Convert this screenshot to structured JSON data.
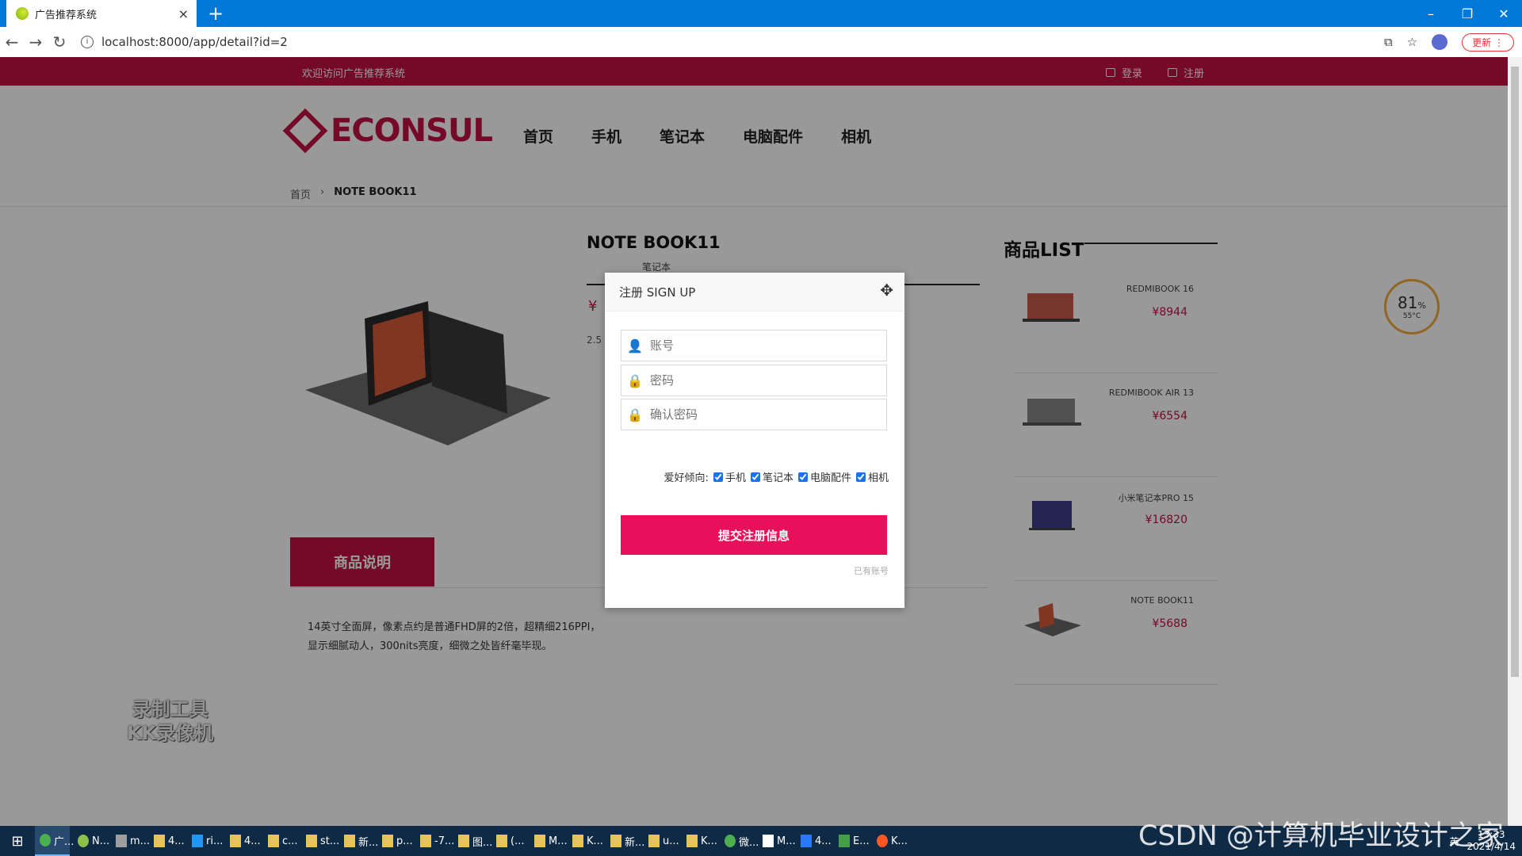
{
  "browser": {
    "tab_title": "广告推荐系统",
    "tab_close": "×",
    "new_tab": "+",
    "url": "localhost:8000/app/detail?id=2",
    "update_button": "更新",
    "window_controls": [
      "–",
      "❐",
      "✕"
    ]
  },
  "site": {
    "welcome": "欢迎访问广告推荐系统",
    "login": "登录",
    "register": "注册",
    "logo": "ECONSUL",
    "nav": [
      "首页",
      "手机",
      "笔记本",
      "电脑配件",
      "相机"
    ],
    "breadcrumb": {
      "home": "首页",
      "current": "NOTE BOOK11"
    }
  },
  "product": {
    "title": "NOTE BOOK11",
    "category": "笔记本",
    "price_symbol": "¥",
    "misc": "2.5",
    "description_tab": "商品说明",
    "description": "14英寸全面屏，像素点约是普通FHD屏的2倍，超精细216PPI，显示细腻动人，300nits亮度，细微之处皆纤毫毕现。"
  },
  "product_list": {
    "title": "商品LIST",
    "items": [
      {
        "name": "REDMIBOOK 16",
        "price": "¥8944"
      },
      {
        "name": "REDMIBOOK AIR 13",
        "price": "¥6554"
      },
      {
        "name": "小米笔记本PRO 15",
        "price": "¥16820"
      },
      {
        "name": "NOTE BOOK11",
        "price": "¥5688"
      }
    ]
  },
  "modal": {
    "title": "注册 SIGN UP",
    "account_placeholder": "账号",
    "password_placeholder": "密码",
    "confirm_placeholder": "确认密码",
    "prefs_label": "爱好倾向:",
    "prefs": [
      "手机",
      "笔记本",
      "电脑配件",
      "相机"
    ],
    "submit": "提交注册信息",
    "have_account": "已有账号"
  },
  "gauge": {
    "percent": "81",
    "unit": "%",
    "temp": "55°C"
  },
  "watermark": {
    "line1": "录制工具",
    "line2": "KK录像机",
    "csdn": "CSDN @计算机毕业设计之家"
  },
  "taskbar": {
    "items": [
      "广...",
      "N...",
      "m...",
      "4...",
      "ri...",
      "4...",
      "c...",
      "st...",
      "新...",
      "p...",
      "-7...",
      "图...",
      "(...",
      "M...",
      "K...",
      "新...",
      "u...",
      "K...",
      "微...",
      "M...",
      "4...",
      "E...",
      "K..."
    ],
    "lang": "英",
    "time": "13:33",
    "date": "2021/4/14"
  }
}
